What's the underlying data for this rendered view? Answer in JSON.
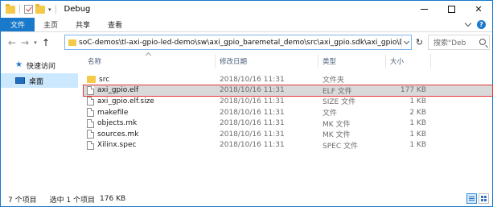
{
  "window": {
    "title": "Debug",
    "minimize": "—",
    "maximize": "",
    "close": "✕"
  },
  "ribbon": {
    "tabs": [
      "文件",
      "主页",
      "共享",
      "查看"
    ],
    "help": "?"
  },
  "address": {
    "path": "soC-demos\\tl-axi-gpio-led-demo\\sw\\axi_gpio_baremetal_demo\\src\\axi_gpio.sdk\\axi_gpio\\Debug",
    "search_placeholder": "搜索\"Deb"
  },
  "nav": {
    "items": [
      {
        "label": "快速访问",
        "icon": "star-icon"
      },
      {
        "label": "桌面",
        "icon": "desktop-icon"
      }
    ]
  },
  "columns": {
    "name": "名称",
    "date": "修改日期",
    "type": "类型",
    "size": "大小"
  },
  "files": [
    {
      "name": "src",
      "date": "2018/10/16 11:31",
      "type": "文件夹",
      "size": "",
      "icon": "folder-icon"
    },
    {
      "name": "axi_gpio.elf",
      "date": "2018/10/16 11:31",
      "type": "ELF 文件",
      "size": "177 KB",
      "icon": "file-icon"
    },
    {
      "name": "axi_gpio.elf.size",
      "date": "2018/10/16 11:31",
      "type": "SIZE 文件",
      "size": "1 KB",
      "icon": "file-icon"
    },
    {
      "name": "makefile",
      "date": "2018/10/16 11:31",
      "type": "文件",
      "size": "2 KB",
      "icon": "file-icon"
    },
    {
      "name": "objects.mk",
      "date": "2018/10/16 11:31",
      "type": "MK 文件",
      "size": "1 KB",
      "icon": "file-icon"
    },
    {
      "name": "sources.mk",
      "date": "2018/10/16 11:31",
      "type": "MK 文件",
      "size": "1 KB",
      "icon": "file-icon"
    },
    {
      "name": "Xilinx.spec",
      "date": "2018/10/16 11:31",
      "type": "SPEC 文件",
      "size": "1 KB",
      "icon": "file-icon"
    }
  ],
  "status": {
    "count": "7 个项目",
    "selected": "选中 1 个项目",
    "selected_size": "176 KB"
  }
}
